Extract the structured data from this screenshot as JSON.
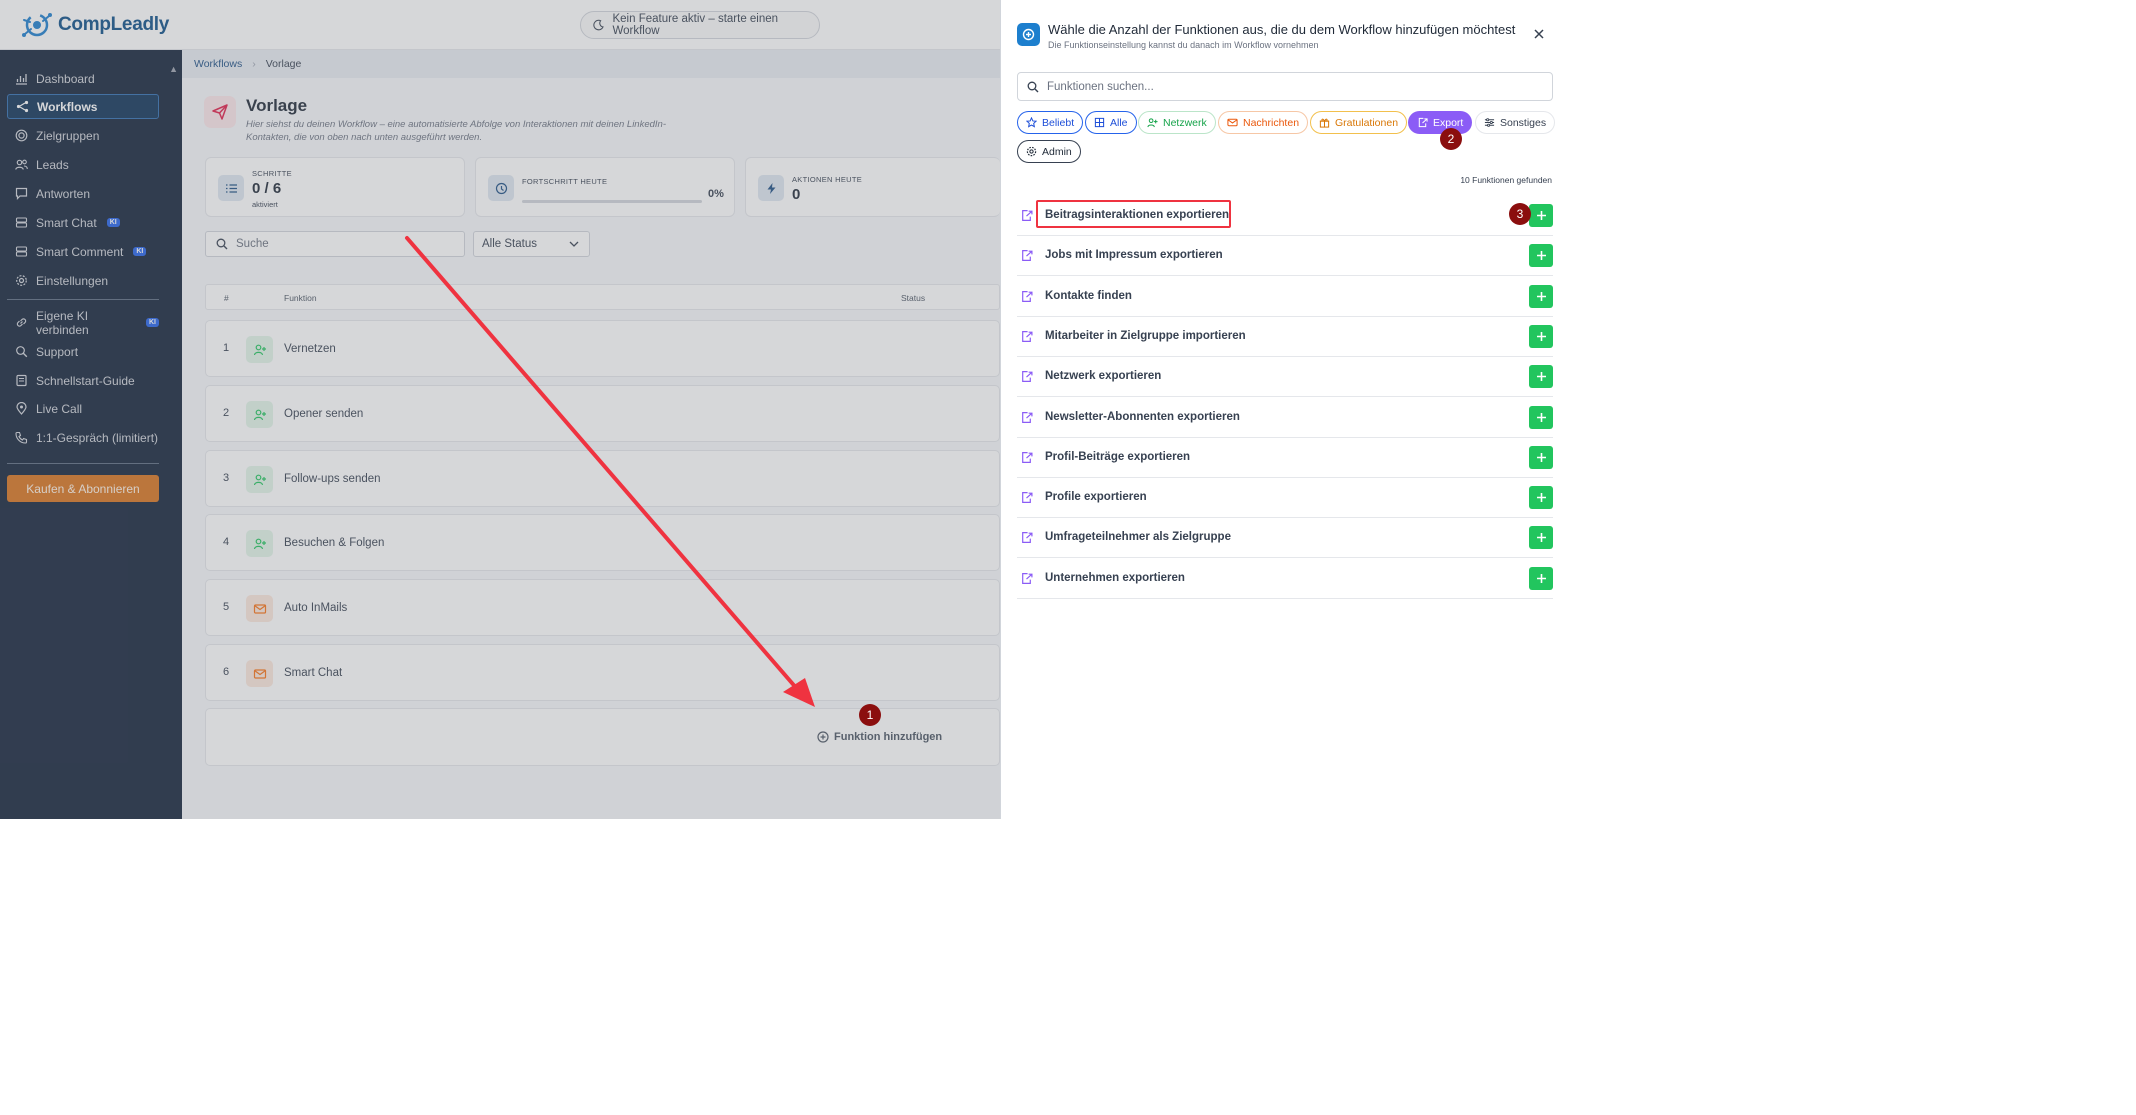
{
  "header": {
    "brand_name": "CompLeadly",
    "feature_status": "Kein Feature aktiv – starte einen Workflow"
  },
  "sidebar": {
    "items": [
      {
        "label": "Dashboard",
        "icon": "chart-icon"
      },
      {
        "label": "Workflows",
        "icon": "workflow-icon",
        "active": true
      },
      {
        "label": "Zielgruppen",
        "icon": "target-icon"
      },
      {
        "label": "Leads",
        "icon": "users-icon"
      },
      {
        "label": "Antworten",
        "icon": "chat-icon"
      },
      {
        "label": "Smart Chat",
        "icon": "chat-stack-icon",
        "badge": "KI"
      },
      {
        "label": "Smart Comment",
        "icon": "comment-stack-icon",
        "badge": "KI"
      },
      {
        "label": "Einstellungen",
        "icon": "gear-icon"
      }
    ],
    "secondary_items": [
      {
        "label": "Eigene KI verbinden",
        "icon": "link-icon",
        "badge": "KI"
      },
      {
        "label": "Support",
        "icon": "support-icon"
      },
      {
        "label": "Schnellstart-Guide",
        "icon": "book-icon"
      },
      {
        "label": "Live Call",
        "icon": "pin-icon"
      },
      {
        "label": "1:1-Gespräch (limitiert)",
        "icon": "phone-icon"
      }
    ],
    "buy_button": "Kaufen & Abonnieren"
  },
  "breadcrumb": {
    "parent": "Workflows",
    "current": "Vorlage"
  },
  "page": {
    "title": "Vorlage",
    "subtitle": "Hier siehst du deinen Workflow – eine automatisierte Abfolge von Interaktionen mit deinen LinkedIn-Kontakten, die von oben nach unten ausgeführt werden."
  },
  "stats": {
    "steps": {
      "label": "SCHRITTE",
      "value": "0 / 6",
      "sub": "aktiviert"
    },
    "progress": {
      "label": "FORTSCHRITT HEUTE",
      "value": "0%",
      "fraction": 0
    },
    "actions": {
      "label": "AKTIONEN HEUTE",
      "value": "0"
    }
  },
  "filters": {
    "search_placeholder": "Suche",
    "status_value": "Alle Status"
  },
  "table": {
    "headers": {
      "num": "#",
      "function": "Funktion",
      "status": "Status"
    },
    "rows": [
      {
        "num": "1",
        "name": "Vernetzen",
        "icon": "user-plus-icon",
        "color": "green"
      },
      {
        "num": "2",
        "name": "Opener senden",
        "icon": "user-plus-icon",
        "color": "green"
      },
      {
        "num": "3",
        "name": "Follow-ups senden",
        "icon": "user-plus-icon",
        "color": "green"
      },
      {
        "num": "4",
        "name": "Besuchen & Folgen",
        "icon": "user-plus-icon",
        "color": "green"
      },
      {
        "num": "5",
        "name": "Auto InMails",
        "icon": "mail-icon",
        "color": "orange"
      },
      {
        "num": "6",
        "name": "Smart Chat",
        "icon": "mail-icon",
        "color": "orange"
      }
    ],
    "add_function": "Funktion hinzufügen"
  },
  "panel": {
    "title": "Wähle die Anzahl der Funktionen aus, die du dem Workflow hinzufügen möchtest",
    "subtitle": "Die Funktionseinstellung kannst du danach im Workflow vornehmen",
    "search_placeholder": "Funktionen suchen...",
    "chips": [
      {
        "label": "Beliebt",
        "icon": "star-icon"
      },
      {
        "label": "Alle",
        "icon": "grid-icon"
      },
      {
        "label": "Netzwerk",
        "icon": "user-plus-icon"
      },
      {
        "label": "Nachrichten",
        "icon": "mail-icon"
      },
      {
        "label": "Gratulationen",
        "icon": "gift-icon"
      },
      {
        "label": "Export",
        "icon": "export-icon",
        "active": true
      },
      {
        "label": "Sonstiges",
        "icon": "sliders-icon"
      },
      {
        "label": "Admin",
        "icon": "gear-icon"
      }
    ],
    "found_count": "10 Funktionen gefunden",
    "functions": [
      "Beitragsinteraktionen exportieren",
      "Jobs mit Impressum exportieren",
      "Kontakte finden",
      "Mitarbeiter in Zielgruppe importieren",
      "Netzwerk exportieren",
      "Newsletter-Abonnenten exportieren",
      "Profil-Beiträge exportieren",
      "Profile exportieren",
      "Umfrageteilnehmer als Zielgruppe",
      "Unternehmen exportieren"
    ]
  },
  "annotations": {
    "step_badges": [
      "1",
      "2",
      "3"
    ],
    "arrow_color": "#ef3340",
    "badge_color": "#8b0e0e"
  },
  "colors": {
    "sidebar_bg": "#14233a",
    "accent_blue": "#1d7fce",
    "export_purple": "#8b5cf6",
    "add_green": "#22c55e",
    "buy_orange": "#d9751f"
  }
}
